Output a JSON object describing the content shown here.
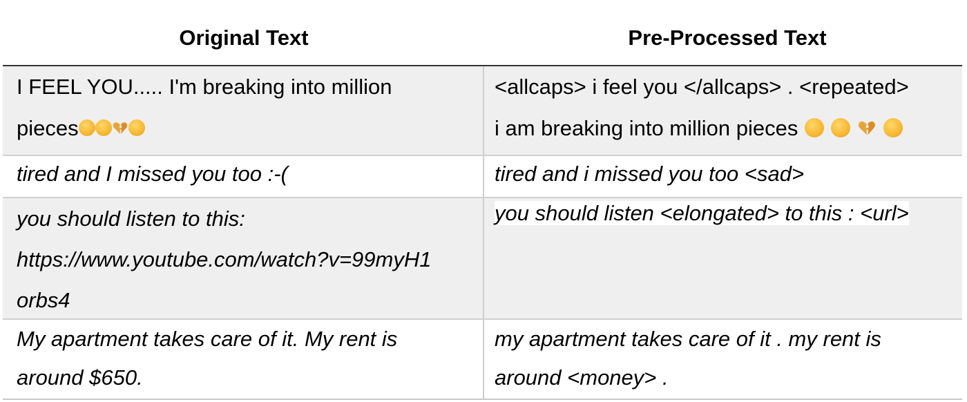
{
  "header": {
    "left": "Original Text",
    "right": "Pre-Processed Text"
  },
  "rows": [
    {
      "original_line1": "I FEEL YOU..... I'm breaking into million",
      "original_line2": "pieces",
      "processed_line1": "<allcaps> i feel you </allcaps> . <repeated>",
      "processed_line2": "i am breaking into million pieces"
    },
    {
      "original": "tired and I missed you too :-(",
      "processed": "tired and i missed you too <sad>"
    },
    {
      "original_line1": "you should listen to this:",
      "original_line2": "https://www.youtube.com/watch?v=99myH1",
      "original_line3": "orbs4",
      "processed": "you should listen <elongated> to this : <url>"
    },
    {
      "original_line1": "My apartment takes care of it. My rent is",
      "original_line2": "around $650.",
      "processed_line1": "my apartment takes care of it . my rent is",
      "processed_line2": "around <money> ."
    }
  ],
  "emojis": [
    "frowning-face-emoji",
    "crying-face-emoji",
    "broken-heart-emoji",
    "disappointed-face-emoji"
  ],
  "colors": {
    "row_shade": "#efefef",
    "emoji_yellow": "#f7b733",
    "heart": "#e8a33a"
  }
}
